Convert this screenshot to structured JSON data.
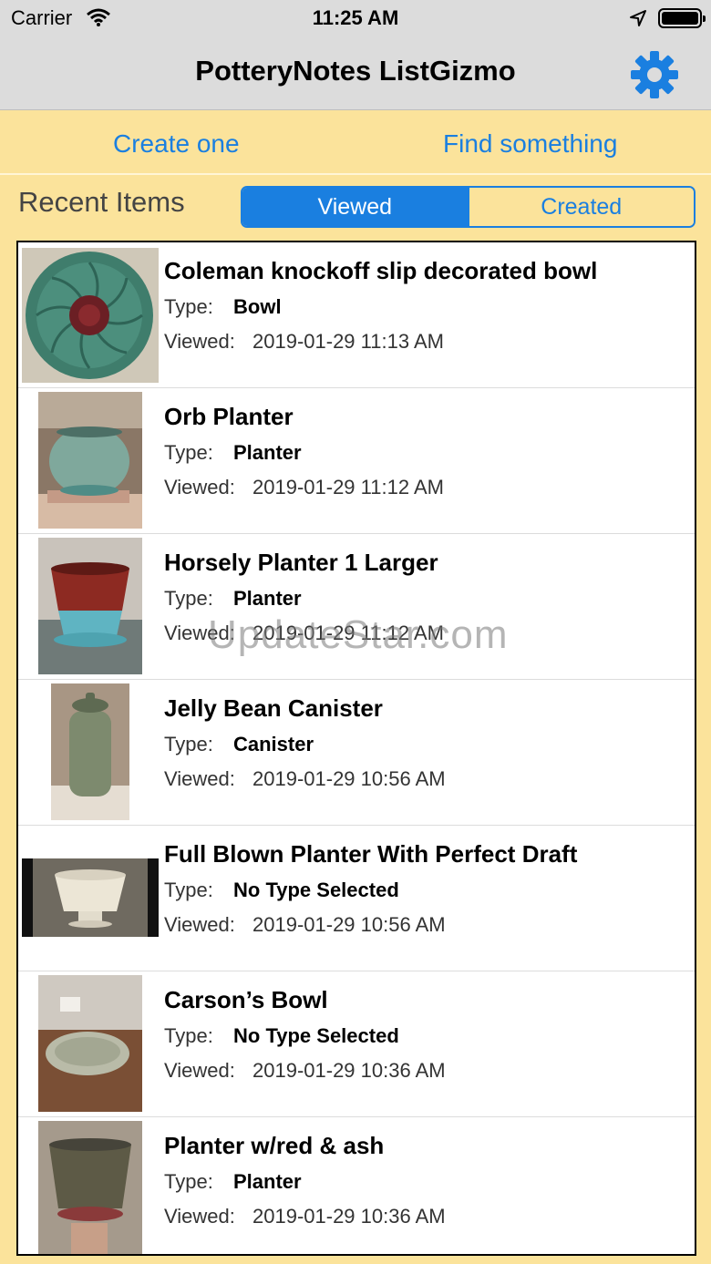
{
  "status_bar": {
    "carrier": "Carrier",
    "time": "11:25 AM"
  },
  "nav": {
    "title": "PotteryNotes ListGizmo",
    "settings_icon": "gear-icon",
    "accent": "#1a7fe0"
  },
  "actions": {
    "create": "Create one",
    "find": "Find something"
  },
  "recent": {
    "label": "Recent Items",
    "segments": {
      "viewed": "Viewed",
      "created": "Created",
      "selected": "Viewed"
    }
  },
  "labels": {
    "type": "Type:",
    "viewed": "Viewed:"
  },
  "items": [
    {
      "title": "Coleman knockoff slip decorated bowl",
      "type": "Bowl",
      "viewed": "2019-01-29 11:13 AM"
    },
    {
      "title": "Orb Planter",
      "type": "Planter",
      "viewed": "2019-01-29 11:12 AM"
    },
    {
      "title": "Horsely Planter 1 Larger",
      "type": "Planter",
      "viewed": "2019-01-29 11:12 AM"
    },
    {
      "title": "Jelly Bean Canister",
      "type": "Canister",
      "viewed": "2019-01-29 10:56 AM"
    },
    {
      "title": "Full Blown Planter With Perfect Draft",
      "type": "No Type Selected",
      "viewed": "2019-01-29 10:56 AM"
    },
    {
      "title": "Carson’s Bowl",
      "type": "No Type Selected",
      "viewed": "2019-01-29 10:36 AM"
    },
    {
      "title": "Planter w/red & ash",
      "type": "Planter",
      "viewed": "2019-01-29 10:36 AM"
    }
  ],
  "watermark": "UpdateStar.com"
}
